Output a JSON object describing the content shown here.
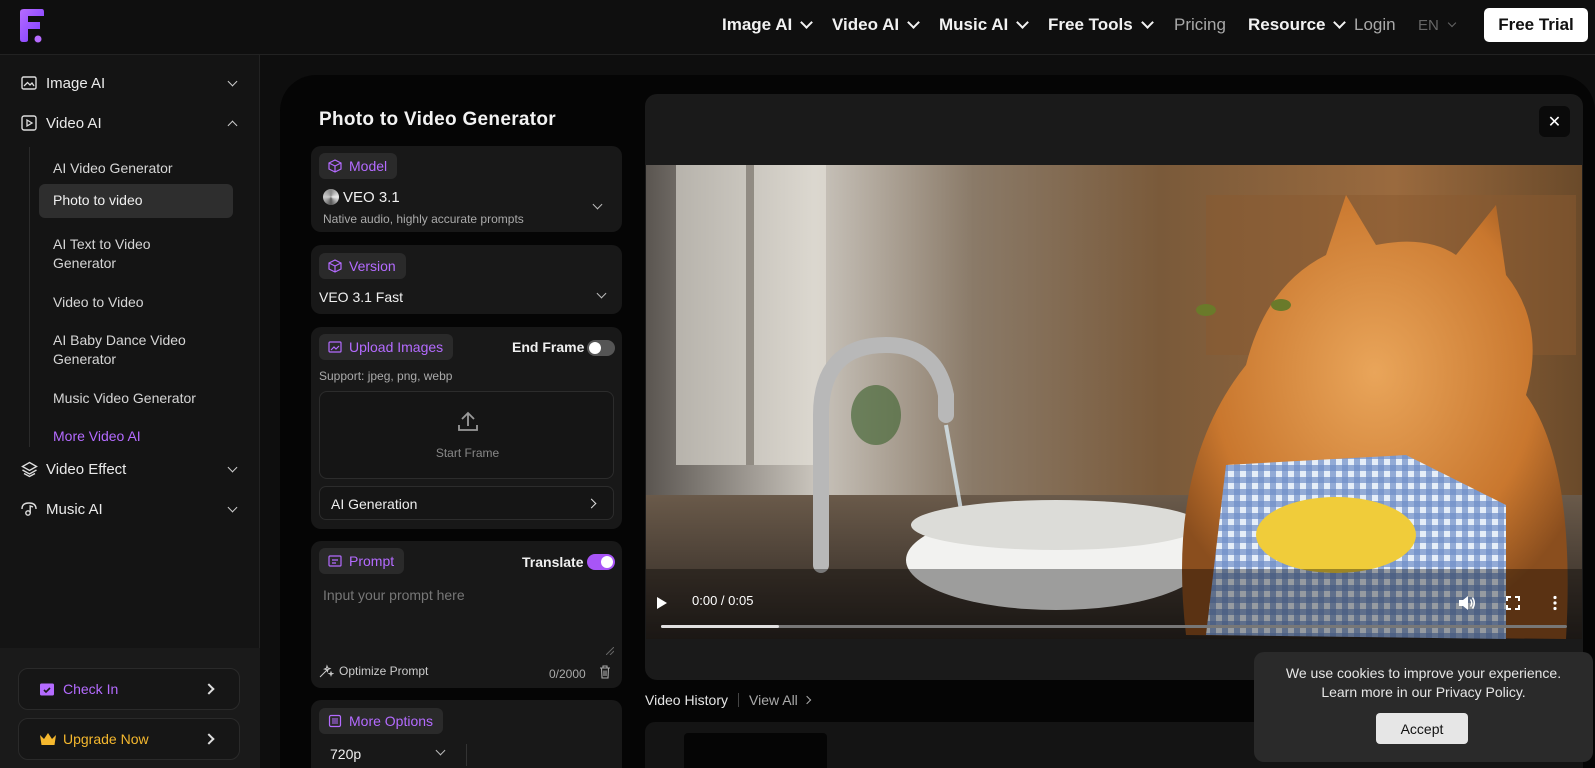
{
  "nav": {
    "items": [
      "Image AI",
      "Video AI",
      "Music AI",
      "Free Tools",
      "Pricing",
      "Resource",
      "Login",
      "EN"
    ],
    "free_trial": "Free Trial"
  },
  "sidebar": {
    "image_ai": "Image AI",
    "video_ai": "Video AI",
    "sub_items": [
      "AI Video Generator",
      "Photo to video",
      "AI Text to Video Generator",
      "Video to Video",
      "AI Baby Dance Video Generator",
      "Music Video Generator",
      "More Video AI"
    ],
    "video_effect": "Video Effect",
    "music_ai": "Music AI",
    "check_in": "Check In",
    "upgrade": "Upgrade Now"
  },
  "panel": {
    "title": "Photo to Video Generator",
    "model_tag": "Model",
    "model_name": "VEO 3.1",
    "model_desc": "Native audio, highly accurate prompts",
    "version_tag": "Version",
    "version_value": "VEO 3.1 Fast",
    "upload_tag": "Upload Images",
    "end_frame": "End Frame",
    "support": "Support: jpeg, png, webp",
    "start_frame": "Start Frame",
    "ai_generation": "AI Generation",
    "prompt_tag": "Prompt",
    "translate": "Translate",
    "prompt_placeholder": "Input your prompt here",
    "optimize": "Optimize Prompt",
    "char_count": "0/2000",
    "more_options": "More Options",
    "resolution": "720p"
  },
  "video": {
    "time": "0:00 / 0:05",
    "progress": 0.13
  },
  "history": {
    "label": "Video History",
    "view_all": "View All"
  },
  "cookie": {
    "line1": "We use cookies to improve your experience.",
    "line2": "Learn more in our Privacy Policy.",
    "accept": "Accept"
  },
  "colors": {
    "accent": "#b46bff",
    "toggle_on": "#a855f7"
  }
}
